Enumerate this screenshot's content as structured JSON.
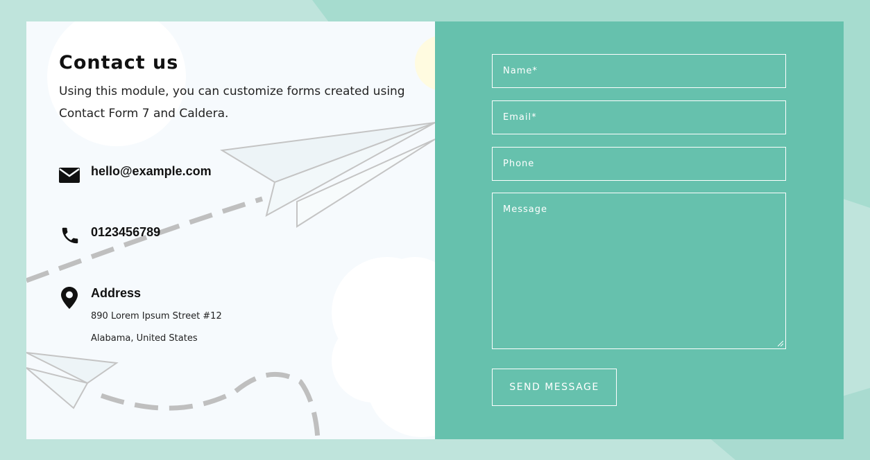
{
  "contact": {
    "title": "Contact us",
    "description": "Using this module, you can customize forms created using Contact Form 7 and Caldera.",
    "email": "hello@example.com",
    "phone": "0123456789",
    "address_title": "Address",
    "address_line1": "890 Lorem Ipsum Street #12",
    "address_line2": "Alabama, United States"
  },
  "form": {
    "name_placeholder": "Name*",
    "email_placeholder": "Email*",
    "phone_placeholder": "Phone",
    "message_placeholder": "Message",
    "submit_label": "SEND MESSAGE"
  },
  "icons": {
    "email": "envelope-icon",
    "phone": "phone-icon",
    "address": "map-pin-icon"
  },
  "colors": {
    "page_background": "#bfe4dc",
    "panel_background": "#f6fafd",
    "form_background": "#66c1ad",
    "form_border": "#ffffff"
  }
}
